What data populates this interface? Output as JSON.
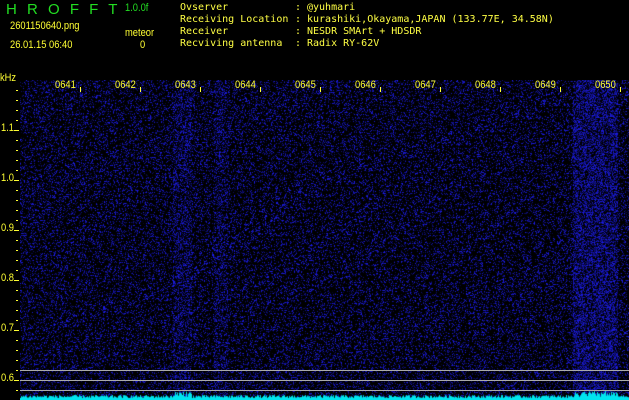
{
  "header": {
    "app_title": "H R O F F T",
    "version": "1.0.0f",
    "filename": "2601150640.png",
    "datetime": "26.01.15 06:40",
    "meteor_label": "meteor",
    "meteor_count": "0"
  },
  "info": [
    {
      "label": "Ovserver",
      "sep": ":",
      "value": "@yuhmari"
    },
    {
      "label": "Receiving Location",
      "sep": ":",
      "value": "kurashiki,Okayama,JAPAN (133.77E, 34.58N)"
    },
    {
      "label": "Receiver",
      "sep": ":",
      "value": "NESDR SMArt + HDSDR"
    },
    {
      "label": "Recviving antenna",
      "sep": ":",
      "value": "Radix RY-62V"
    }
  ],
  "yaxis": {
    "unit": "kHz",
    "ticks": [
      "1.1",
      "1.0",
      "0.9",
      "0.8",
      "0.7",
      "0.6"
    ]
  },
  "xaxis": {
    "ticks": [
      "0641",
      "0642",
      "0643",
      "0644",
      "0645",
      "0646",
      "0647",
      "0648",
      "0649",
      "0650"
    ]
  },
  "colors": {
    "noise": "#2020ff",
    "spectrum": "#00e5ee",
    "text": "#ffff33",
    "title": "#22dd22"
  }
}
